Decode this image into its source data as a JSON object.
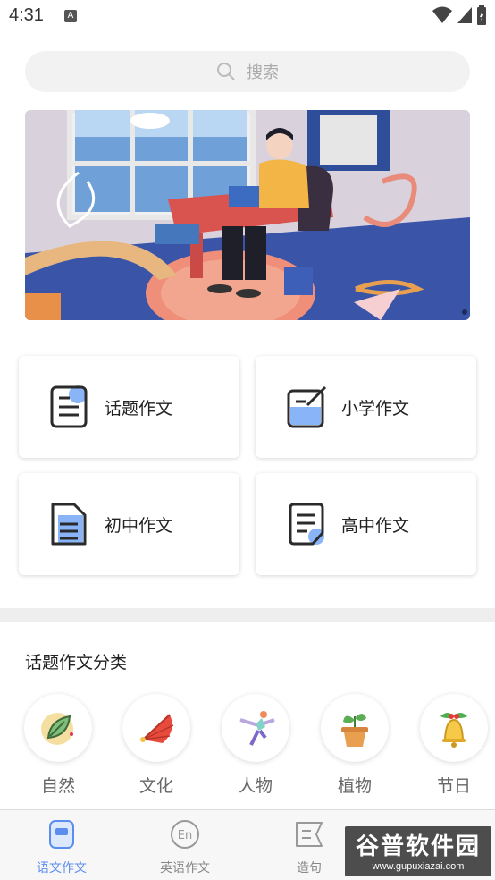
{
  "status_bar": {
    "time": "4:31",
    "notification_glyph": "A"
  },
  "search": {
    "placeholder": "搜索"
  },
  "cards": [
    {
      "label": "话题作文",
      "icon": "document-icon"
    },
    {
      "label": "小学作文",
      "icon": "edit-icon"
    },
    {
      "label": "初中作文",
      "icon": "file-icon"
    },
    {
      "label": "高中作文",
      "icon": "paper-icon"
    }
  ],
  "section": {
    "title": "话题作文分类"
  },
  "categories": [
    {
      "label": "自然",
      "icon": "leaf-icon"
    },
    {
      "label": "文化",
      "icon": "fan-icon"
    },
    {
      "label": "人物",
      "icon": "skater-icon"
    },
    {
      "label": "植物",
      "icon": "potted-plant-icon"
    },
    {
      "label": "节日",
      "icon": "bell-icon"
    }
  ],
  "tabs": [
    {
      "label": "语文作文",
      "active": true
    },
    {
      "label": "英语作文",
      "active": false
    },
    {
      "label": "造句",
      "active": false
    }
  ],
  "watermark": {
    "title": "谷普软件园",
    "url": "www.gupuxiazai.com"
  },
  "colors": {
    "accent": "#5b8def",
    "icon_blue": "#8ab4f8",
    "banner_bg": "#d9d2dc"
  }
}
